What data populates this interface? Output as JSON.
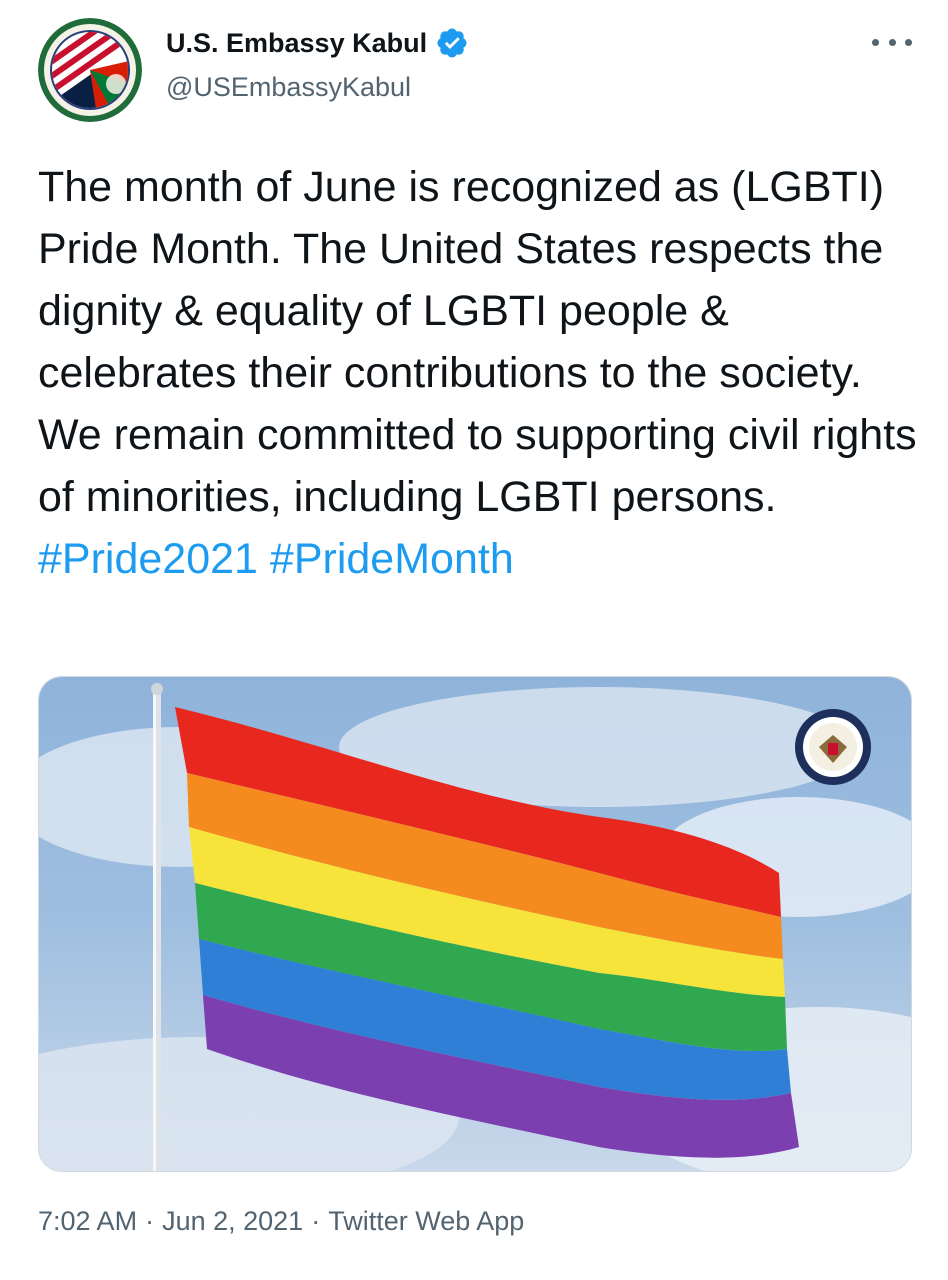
{
  "account": {
    "display_name": "U.S. Embassy Kabul",
    "handle": "@USEmbassyKabul",
    "verified": true
  },
  "tweet": {
    "text_main": "The month of June is recognized as (LGBTI) Pride Month. The United States respects the dignity & equality of LGBTI people & celebrates their contributions to the society. We remain committed to supporting civil rights of minorities, including LGBTI persons.",
    "hashtags": [
      "#Pride2021",
      "#PrideMonth"
    ]
  },
  "media": {
    "image_subject": "rainbow-pride-flag",
    "stripe_colors": [
      "#e8281e",
      "#f58a1f",
      "#f7e43a",
      "#2fa84f",
      "#2f7fd6",
      "#7b3fb0"
    ],
    "emblem": "us-department-of-state-seal"
  },
  "meta": {
    "time": "7:02 AM",
    "date": "Jun 2, 2021",
    "source": "Twitter Web App",
    "separator": "·"
  },
  "colors": {
    "accent": "#1d9bf0",
    "text": "#0f1419",
    "secondary_text": "#536471"
  }
}
